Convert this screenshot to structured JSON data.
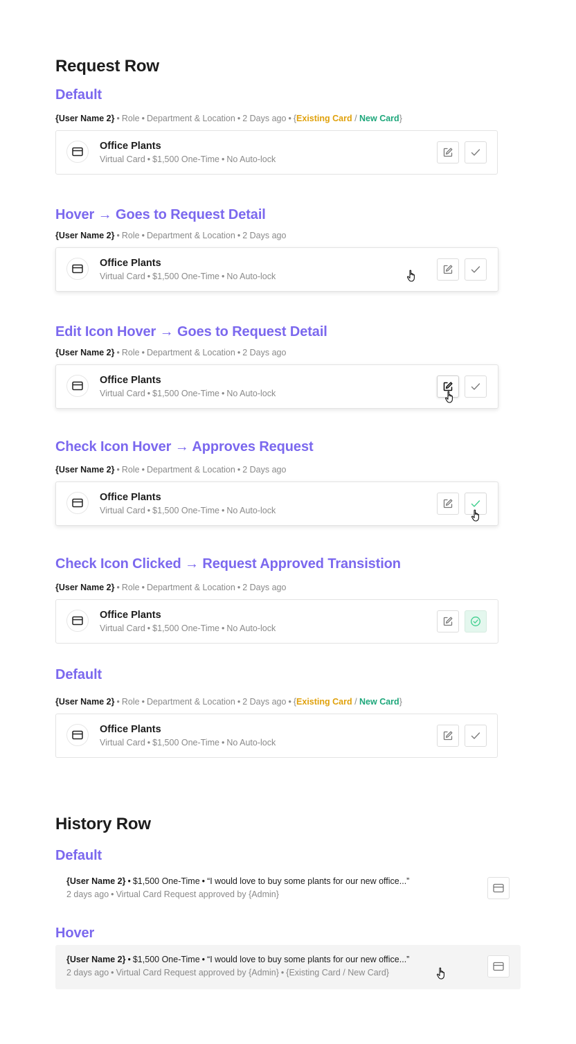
{
  "request_section": {
    "title": "Request Row",
    "states": [
      {
        "label": "Default"
      },
      {
        "label": "Hover → Goes to Request Detail"
      },
      {
        "label": "Edit Icon Hover → Goes to Request Detail"
      },
      {
        "label": "Check Icon Hover → Approves Request"
      },
      {
        "label": "Check Icon Clicked → Request Approved Transistion"
      },
      {
        "label": "Default"
      }
    ],
    "meta": {
      "user": "{User Name 2}",
      "role": "Role",
      "department": "Department & Location",
      "age": "2 Days ago",
      "sep": "•",
      "brace_open": "{",
      "existing_card": "Existing Card",
      "slash": " / ",
      "new_card": "New Card",
      "brace_close": "}"
    },
    "row": {
      "title": "Office Plants",
      "type": "Virtual Card",
      "amount": "$1,500 One-Time",
      "lock": "No Auto-lock",
      "sep": "•",
      "card_icon": "credit-card-icon",
      "edit_icon": "edit-icon",
      "check_icon": "check-icon",
      "check_done_icon": "check-circle-icon"
    }
  },
  "history_section": {
    "title": "History Row",
    "states": [
      {
        "label": "Default"
      },
      {
        "label": "Hover"
      }
    ],
    "row": {
      "user": "{User Name 2}",
      "amount": "$1,500 One-Time",
      "quote": "“I would love to buy some plants for our new office...”",
      "age": "2 days ago",
      "status": "Virtual Card Request approved by {Admin}",
      "card_choice": "{Existing Card / New Card}",
      "sep": "•",
      "card_icon": "credit-card-icon"
    }
  },
  "colors": {
    "accent": "#7b68ee",
    "existing_card": "#e0a10c",
    "new_card": "#1ea77b",
    "approved_bg": "#e4f7ee",
    "approved_check": "#3fcf8e"
  }
}
